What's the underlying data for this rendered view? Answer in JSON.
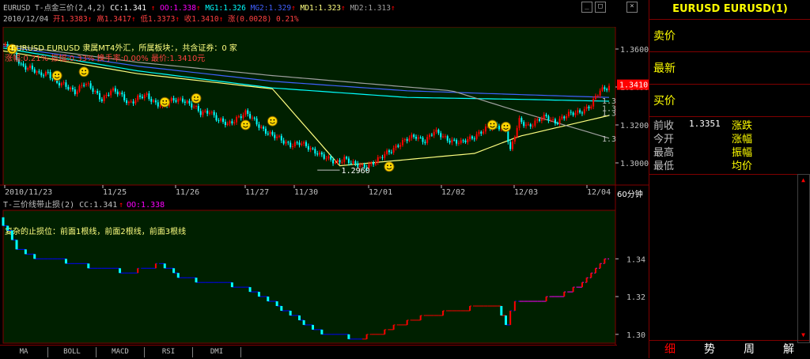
{
  "header": {
    "line1": [
      {
        "t": "EURUSD T-点金三价(2,4,2)",
        "c": "#c0c0c0"
      },
      {
        "t": " CC:1.341",
        "c": "#ffffff"
      },
      {
        "t": " ↑",
        "c": "#ff0000"
      },
      {
        "t": " OO:1.338",
        "c": "#ff00ff"
      },
      {
        "t": "↑",
        "c": "#ff0000"
      },
      {
        "t": " MG1:1.326",
        "c": "#00ffff"
      },
      {
        "t": " MG2:1.329",
        "c": "#4060ff"
      },
      {
        "t": "↑",
        "c": "#ff0000"
      },
      {
        "t": " MD1:1.323",
        "c": "#ffff80"
      },
      {
        "t": "↑",
        "c": "#ff0000"
      },
      {
        "t": " MD2:1.313",
        "c": "#a0a0a0"
      },
      {
        "t": "↑",
        "c": "#ff0000"
      }
    ],
    "line2": [
      {
        "t": "2010/12/04",
        "c": "#c0c0c0"
      },
      {
        "t": " 开1.3383",
        "c": "#ff4040"
      },
      {
        "t": "↑",
        "c": "#ff0000"
      },
      {
        "t": " 高1.3417",
        "c": "#ff4040"
      },
      {
        "t": "↑",
        "c": "#ff0000"
      },
      {
        "t": " 低1.3373",
        "c": "#ff4040"
      },
      {
        "t": "↑",
        "c": "#ff0000"
      },
      {
        "t": " 收1.3410",
        "c": "#ff4040"
      },
      {
        "t": "↑",
        "c": "#ff0000"
      },
      {
        "t": " 涨(0.0028)",
        "c": "#ff4040"
      },
      {
        "t": " 0.21%",
        "c": "#ff4040"
      }
    ]
  },
  "overlay": {
    "info_line": "EURUSD EURUSD 隶属MT4外汇，所属板块：，共含证券：0 家",
    "stat_line": "涨幅:0.21% 振幅:0.33% 换手率:0.00% 最价:1.3410元"
  },
  "sub_chart": {
    "title": "T-三价线带止损(2) CC:1.341",
    "title_arrow": "↑",
    "title_oo": "OO:1.338",
    "annotation": "复杂的止损位：前面1根线，前面2根线，前面3根线"
  },
  "period_label": "60分钟",
  "panel": {
    "title": "EURUSD EURUSD(1)",
    "rows": [
      "卖价",
      "最新",
      "买价"
    ],
    "stats": {
      "prev_close_label": "前收",
      "prev_close_value": "1.3351",
      "open_label": "今开",
      "high_label": "最高",
      "low_label": "最低",
      "change_label": "涨跌",
      "change_pct_label": "涨幅",
      "amplitude_label": "振幅",
      "avg_label": "均价"
    },
    "tabs": [
      "细",
      "势",
      "周",
      "解"
    ]
  },
  "indicator_tabs": [
    "MA",
    "BOLL",
    "MACD",
    "RSI",
    "DMI"
  ],
  "window_controls": [
    "_",
    "□",
    "×"
  ],
  "colors": {
    "up": "#ff0000",
    "down": "#00ffff",
    "bg": "#000000",
    "grid": "#800000",
    "panel_text": "#ffff00",
    "main_bg": "#002000"
  },
  "chart_data": [
    {
      "type": "candlestick",
      "x_ticks": [
        "2010/11/23",
        "11/25",
        "11/26",
        "11/27",
        "11/30",
        "12/01",
        "12/02",
        "12/03",
        "12/04"
      ],
      "y_ticks": [
        "1.3600",
        "1.3400",
        "1.3200",
        "1.3000"
      ],
      "ylim": [
        1.29,
        1.37
      ],
      "last_price_label": "1.3410",
      "low_label": "1.2960",
      "right_labels": [
        "1.3",
        "1.3",
        "1.3",
        "1.3"
      ],
      "close_path": [
        [
          0,
          1.362
        ],
        [
          4,
          1.358
        ],
        [
          8,
          1.352
        ],
        [
          12,
          1.35
        ],
        [
          16,
          1.346
        ],
        [
          20,
          1.348
        ],
        [
          24,
          1.342
        ],
        [
          28,
          1.34
        ],
        [
          32,
          1.338
        ],
        [
          36,
          1.342
        ],
        [
          40,
          1.338
        ],
        [
          44,
          1.334
        ],
        [
          48,
          1.338
        ],
        [
          52,
          1.336
        ],
        [
          56,
          1.332
        ],
        [
          60,
          1.334
        ],
        [
          64,
          1.335
        ],
        [
          68,
          1.332
        ],
        [
          72,
          1.33
        ],
        [
          76,
          1.333
        ],
        [
          80,
          1.334
        ],
        [
          84,
          1.33
        ],
        [
          88,
          1.326
        ],
        [
          92,
          1.328
        ],
        [
          96,
          1.322
        ],
        [
          100,
          1.32
        ],
        [
          104,
          1.324
        ],
        [
          108,
          1.326
        ],
        [
          112,
          1.322
        ],
        [
          116,
          1.318
        ],
        [
          120,
          1.314
        ],
        [
          124,
          1.312
        ],
        [
          128,
          1.31
        ],
        [
          132,
          1.31
        ],
        [
          136,
          1.308
        ],
        [
          140,
          1.306
        ],
        [
          144,
          1.302
        ],
        [
          148,
          1.3
        ],
        [
          152,
          1.303
        ],
        [
          156,
          1.299
        ],
        [
          160,
          1.298
        ],
        [
          164,
          1.3
        ],
        [
          168,
          1.302
        ],
        [
          172,
          1.306
        ],
        [
          176,
          1.31
        ],
        [
          180,
          1.312
        ],
        [
          184,
          1.314
        ],
        [
          188,
          1.312
        ],
        [
          192,
          1.316
        ],
        [
          196,
          1.314
        ],
        [
          200,
          1.312
        ],
        [
          204,
          1.31
        ],
        [
          208,
          1.313
        ],
        [
          212,
          1.316
        ],
        [
          216,
          1.318
        ],
        [
          220,
          1.32
        ],
        [
          224,
          1.318
        ],
        [
          226,
          1.306
        ],
        [
          230,
          1.322
        ],
        [
          234,
          1.32
        ],
        [
          238,
          1.322
        ],
        [
          242,
          1.324
        ],
        [
          246,
          1.322
        ],
        [
          250,
          1.324
        ],
        [
          254,
          1.326
        ],
        [
          258,
          1.328
        ],
        [
          262,
          1.33
        ],
        [
          266,
          1.338
        ],
        [
          270,
          1.341
        ]
      ],
      "series": [
        {
          "name": "MG1",
          "color": "#00ffff",
          "values": [
            [
              0,
              1.3605
            ],
            [
              60,
              1.3485
            ],
            [
              120,
              1.3395
            ],
            [
              180,
              1.3345
            ],
            [
              230,
              1.3335
            ],
            [
              270,
              1.3325
            ]
          ]
        },
        {
          "name": "MG2",
          "color": "#4060ff",
          "values": [
            [
              0,
              1.3615
            ],
            [
              60,
              1.351
            ],
            [
              120,
              1.343
            ],
            [
              180,
              1.338
            ],
            [
              230,
              1.336
            ],
            [
              270,
              1.3345
            ]
          ]
        },
        {
          "name": "MD1",
          "color": "#ffff80",
          "values": [
            [
              0,
              1.359
            ],
            [
              60,
              1.347
            ],
            [
              120,
              1.339
            ],
            [
              150,
              1.2985
            ],
            [
              210,
              1.305
            ],
            [
              230,
              1.314
            ],
            [
              270,
              1.325
            ]
          ]
        },
        {
          "name": "MD2",
          "color": "#a0a0a0",
          "values": [
            [
              0,
              1.3625
            ],
            [
              60,
              1.353
            ],
            [
              120,
              1.346
            ],
            [
              200,
              1.338
            ],
            [
              230,
              1.327
            ],
            [
              270,
              1.313
            ]
          ]
        }
      ],
      "markers": [
        [
          4,
          1.36
        ],
        [
          24,
          1.346
        ],
        [
          36,
          1.348
        ],
        [
          72,
          1.332
        ],
        [
          86,
          1.334
        ],
        [
          108,
          1.32
        ],
        [
          120,
          1.322
        ],
        [
          172,
          1.298
        ],
        [
          218,
          1.32
        ],
        [
          224,
          1.319
        ]
      ]
    },
    {
      "type": "step",
      "title": "T-三价线带止损(2)",
      "y_ticks": [
        "1.34",
        "1.32",
        "1.30"
      ],
      "ylim": [
        1.297,
        1.364
      ],
      "stop_path": [
        [
          0,
          1.362
        ],
        [
          8,
          1.346
        ],
        [
          16,
          1.341
        ],
        [
          24,
          1.34
        ],
        [
          32,
          1.338
        ],
        [
          40,
          1.336
        ],
        [
          48,
          1.335
        ],
        [
          56,
          1.333
        ],
        [
          64,
          1.334
        ],
        [
          72,
          1.337
        ],
        [
          80,
          1.331
        ],
        [
          88,
          1.328
        ],
        [
          96,
          1.327
        ],
        [
          104,
          1.326
        ],
        [
          112,
          1.323
        ],
        [
          120,
          1.318
        ],
        [
          128,
          1.312
        ],
        [
          136,
          1.306
        ],
        [
          144,
          1.3
        ],
        [
          152,
          1.299
        ],
        [
          160,
          1.298
        ],
        [
          168,
          1.3
        ],
        [
          176,
          1.304
        ],
        [
          184,
          1.308
        ],
        [
          192,
          1.31
        ],
        [
          200,
          1.312
        ],
        [
          208,
          1.313
        ],
        [
          216,
          1.316
        ],
        [
          222,
          1.314
        ],
        [
          226,
          1.305
        ],
        [
          230,
          1.318
        ],
        [
          240,
          1.318
        ],
        [
          248,
          1.32
        ],
        [
          256,
          1.324
        ],
        [
          262,
          1.33
        ],
        [
          266,
          1.336
        ],
        [
          270,
          1.339
        ]
      ]
    }
  ]
}
